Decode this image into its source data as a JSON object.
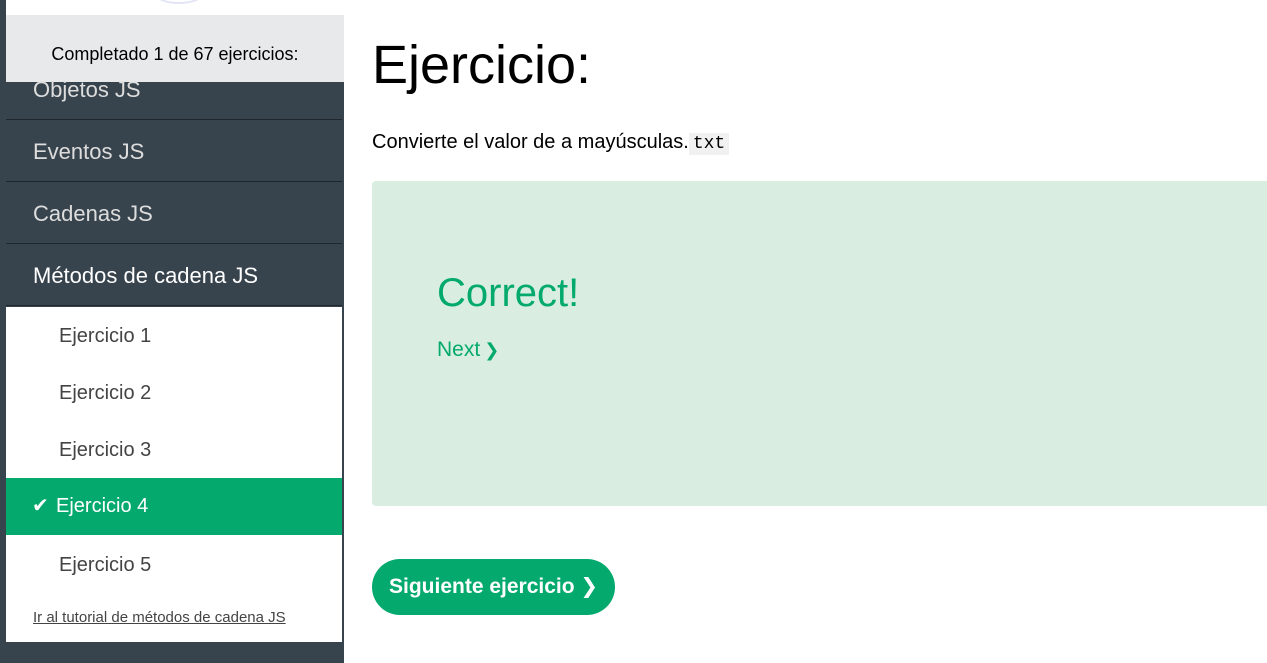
{
  "sidebar": {
    "progress_text": "Completado 1 de 67 ejercicios:",
    "categories": [
      {
        "label": "Objetos JS"
      },
      {
        "label": "Eventos JS"
      },
      {
        "label": "Cadenas JS"
      },
      {
        "label": "Métodos de cadena JS"
      }
    ],
    "exercises": [
      {
        "label": "Ejercicio 1"
      },
      {
        "label": "Ejercicio 2"
      },
      {
        "label": "Ejercicio 3"
      },
      {
        "label": "Ejercicio 4",
        "completed": true
      },
      {
        "label": "Ejercicio 5"
      }
    ],
    "tutorial_link": "Ir al tutorial de métodos de cadena JS",
    "check_icon": "✔"
  },
  "main": {
    "heading": "Ejercicio:",
    "instruction": "Convierte el valor de a mayúsculas.",
    "instruction_code": "txt",
    "result": {
      "title": "Correct!",
      "next_label": "Next",
      "next_chevron": "❯"
    },
    "next_button": "Siguiente ejercicio ❯"
  },
  "colors": {
    "accent": "#04aa6d",
    "sidebar_bg": "#38444d",
    "result_bg": "#d9eee1"
  }
}
